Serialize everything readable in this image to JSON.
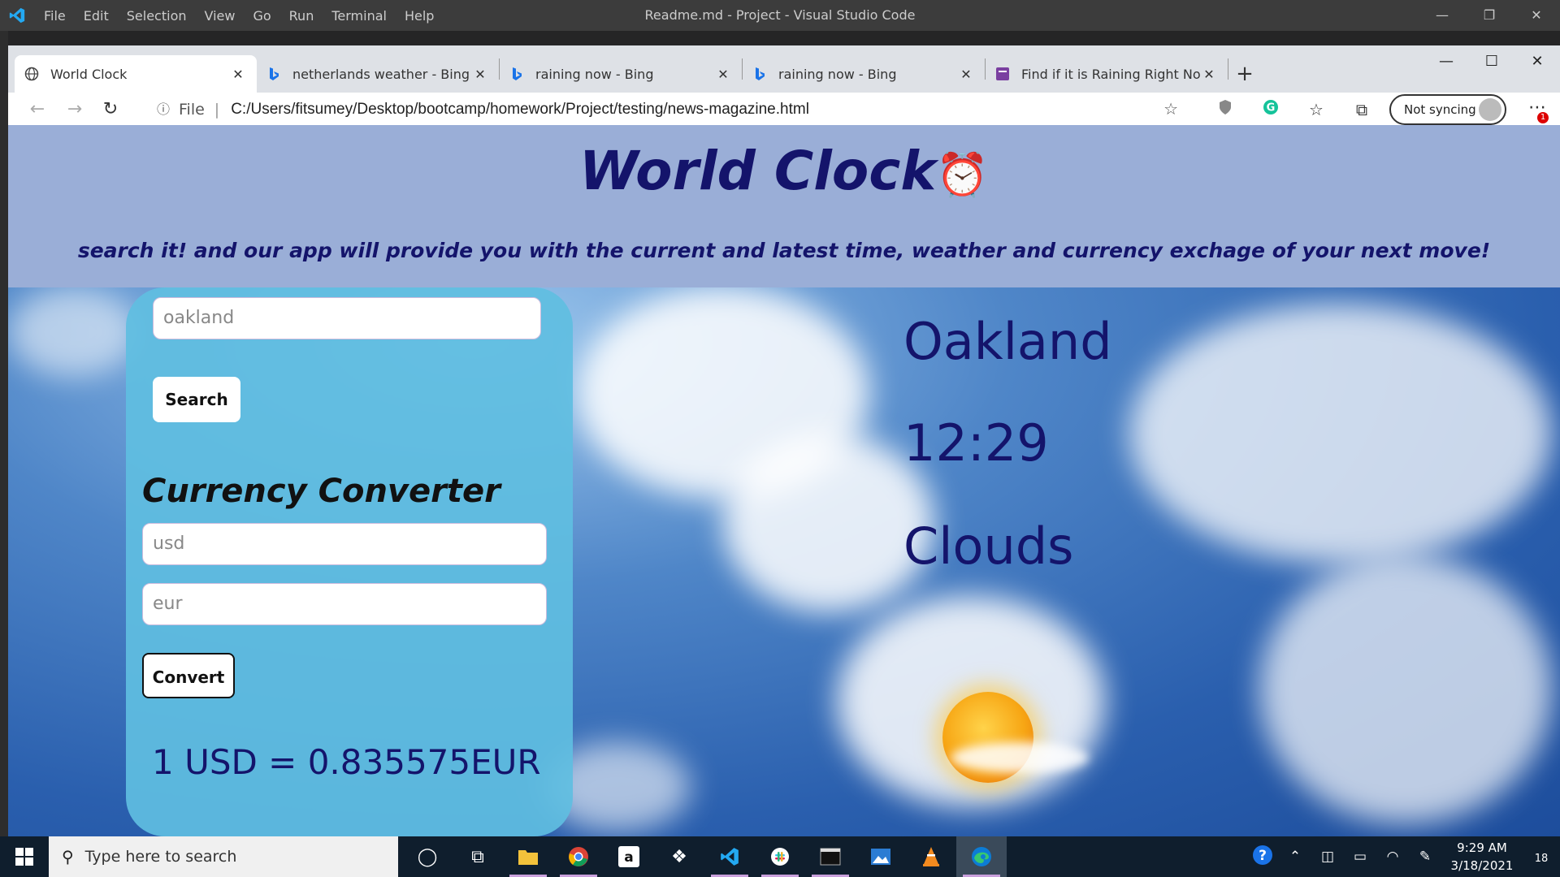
{
  "vscode": {
    "menu": [
      "File",
      "Edit",
      "Selection",
      "View",
      "Go",
      "Run",
      "Terminal",
      "Help"
    ],
    "title": "Readme.md - Project - Visual Studio Code"
  },
  "browser": {
    "tabs": [
      {
        "title": "World Clock",
        "icon": "globe-icon",
        "active": true
      },
      {
        "title": "netherlands weather - Bing",
        "icon": "bing-icon"
      },
      {
        "title": "raining now - Bing",
        "icon": "bing-icon"
      },
      {
        "title": "raining now - Bing",
        "icon": "bing-icon"
      },
      {
        "title": "Find if it is Raining Right Now in",
        "icon": "site-icon"
      }
    ],
    "address": {
      "scheme_label": "File",
      "url": "C:/Users/fitsumey/Desktop/bootcamp/homework/Project/testing/news-magazine.html"
    },
    "sync_label": "Not syncing",
    "notification_count": "1"
  },
  "page": {
    "title": "World Clock",
    "title_emoji": "⏰",
    "subtitle": "search it! and our app will provide you with the current and latest time, weather and currency exchage of your next move!",
    "search": {
      "value": "oakland",
      "button": "Search"
    },
    "converter": {
      "title": "Currency Converter",
      "from": "usd",
      "to": "eur",
      "button": "Convert",
      "result": "1 USD = 0.835575EUR"
    },
    "city": "Oakland",
    "time": "12:29",
    "weather": "Clouds"
  },
  "taskbar": {
    "search_placeholder": "Type here to search",
    "time": "9:29 AM",
    "date": "3/18/2021",
    "notification_badge": "18"
  },
  "colors": {
    "header_bg": "#9aaed7",
    "title_color": "#14146b",
    "panel_bg": "#60bee1"
  }
}
